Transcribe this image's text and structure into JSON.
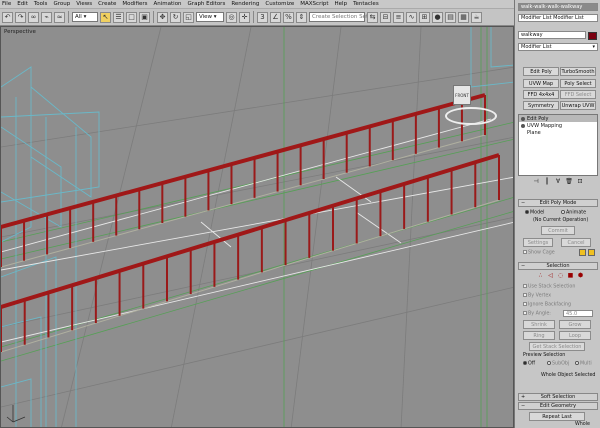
{
  "menu": [
    "File",
    "Edit",
    "Tools",
    "Group",
    "Views",
    "Create",
    "Modifiers",
    "Animation",
    "Graph Editors",
    "Rendering",
    "Customize",
    "MAXScript",
    "Help",
    "Tentacles"
  ],
  "toolbar": {
    "filter_value": "All",
    "view_value": "View",
    "selection_set_placeholder": "Create Selection Set"
  },
  "viewport": {
    "label": "Perspective",
    "viewcube_face": "FRONT"
  },
  "panel": {
    "top_name": "walk-walk-walk-walkway",
    "modifier_list_field": "Modifier List Modifier List",
    "object_name": "walkway",
    "modifier_list_dropdown": "Modifier List",
    "modifier_buttons": [
      [
        "Edit Poly",
        "TurboSmooth"
      ],
      [
        "UVW Map",
        "Poly Select"
      ],
      [
        "FFD 4x4x4",
        "FFD Select"
      ],
      [
        "Symmetry",
        "Unwrap UVW"
      ]
    ],
    "stack_items": [
      "Edit Poly",
      "UVW Mapping",
      "Plane"
    ],
    "edit_poly_mode": {
      "header": "Edit Poly Mode",
      "model": "Model",
      "animate": "Animate",
      "current_op": "(No Current Operation)",
      "commit": "Commit",
      "settings": "Settings",
      "cancel": "Cancel",
      "show_cage": "Show Cage"
    },
    "selection": {
      "header": "Selection",
      "use_stack": "Use Stack Selection",
      "by_vertex": "By Vertex",
      "ignore_back": "Ignore Backfacing",
      "by_angle": "By Angle:",
      "angle_value": "45.0",
      "shrink": "Shrink",
      "grow": "Grow",
      "ring": "Ring",
      "loop": "Loop",
      "get_stack": "Get Stack Selection",
      "preview_title": "Preview Selection",
      "off": "Off",
      "subobj": "SubObj",
      "multi": "Multi",
      "status": "Whole Object Selected"
    },
    "soft_selection": "Soft Selection",
    "edit_geometry": "Edit Geometry",
    "repeat_last": "Repeat Last",
    "bottom_text": "Whole"
  }
}
